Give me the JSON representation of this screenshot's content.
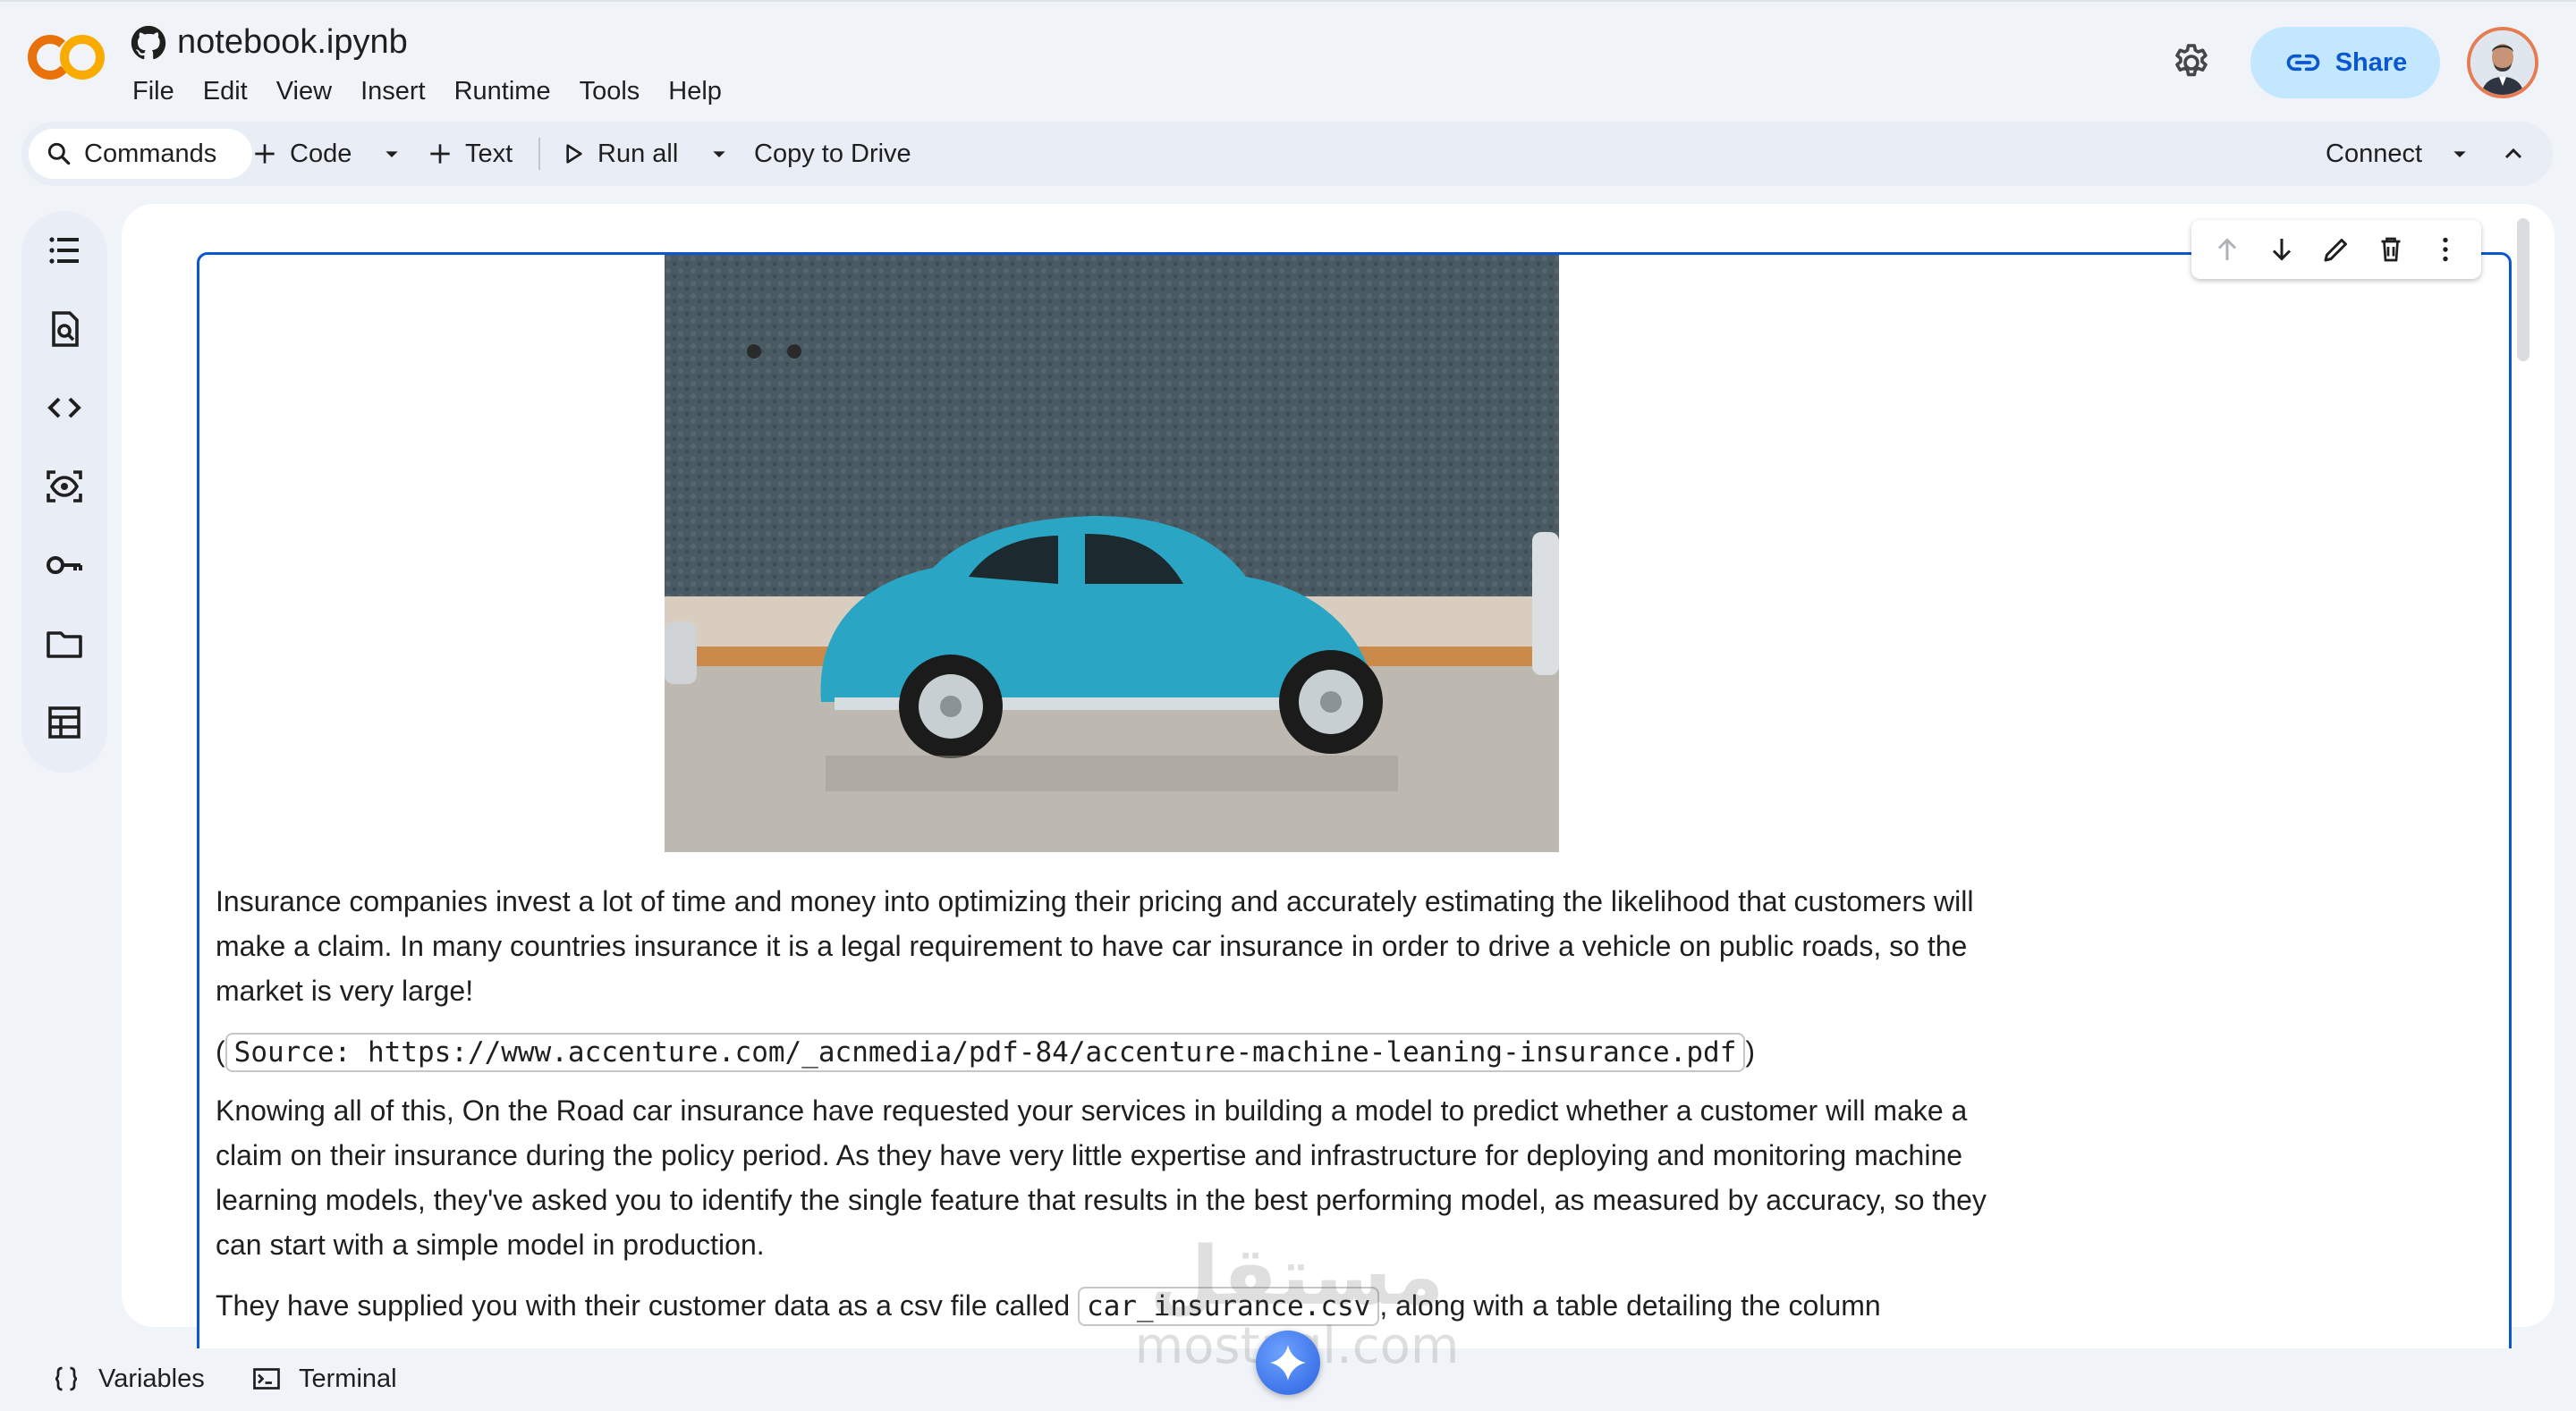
{
  "app": {
    "notebook_name": "notebook.ipynb",
    "brand": "CO"
  },
  "menu": [
    "File",
    "Edit",
    "View",
    "Insert",
    "Runtime",
    "Tools",
    "Help"
  ],
  "header": {
    "share_label": "Share"
  },
  "toolbar": {
    "commands_label": "Commands",
    "code_label": "Code",
    "text_label": "Text",
    "run_all_label": "Run all",
    "copy_to_drive_label": "Copy to Drive",
    "connect_label": "Connect"
  },
  "left_rail": [
    "table-of-contents-icon",
    "find-icon",
    "code-snippets-icon",
    "variables-inspector-icon",
    "secrets-key-icon",
    "files-folder-icon",
    "data-table-icon"
  ],
  "cell": {
    "image_description": "teal-vintage-beetle-car-photo",
    "para1": "Insurance companies invest a lot of time and money into optimizing their pricing and accurately estimating the likelihood that customers will make a claim. In many countries insurance it is a legal requirement to have car insurance in order to drive a vehicle on public roads, so the market is very large!",
    "source_open": "(",
    "source_code": "Source: https://www.accenture.com/_acnmedia/pdf-84/accenture-machine-leaning-insurance.pdf",
    "source_close": ")",
    "para2": "Knowing all of this, On the Road car insurance have requested your services in building a model to predict whether a customer will make a claim on their insurance during the policy period. As they have very little expertise and infrastructure for deploying and monitoring machine learning models, they've asked you to identify the single feature that results in the best performing model, as measured by accuracy, so they can start with a simple model in production.",
    "para3_before": "They have supplied you with their customer data as a csv file called ",
    "para3_code": "car_insurance.csv",
    "para3_after": ", along with a table detailing the column"
  },
  "bottom": {
    "variables_label": "Variables",
    "terminal_label": "Terminal"
  },
  "watermark": {
    "arabic": "مستقل",
    "latin": "mostaql.com"
  },
  "colors": {
    "accent": "#0b57d0",
    "share_bg": "#c2e7ff",
    "page_bg": "#f0f4f9",
    "logo_orange": "#f9ab00",
    "logo_dark_orange": "#e8710a"
  }
}
